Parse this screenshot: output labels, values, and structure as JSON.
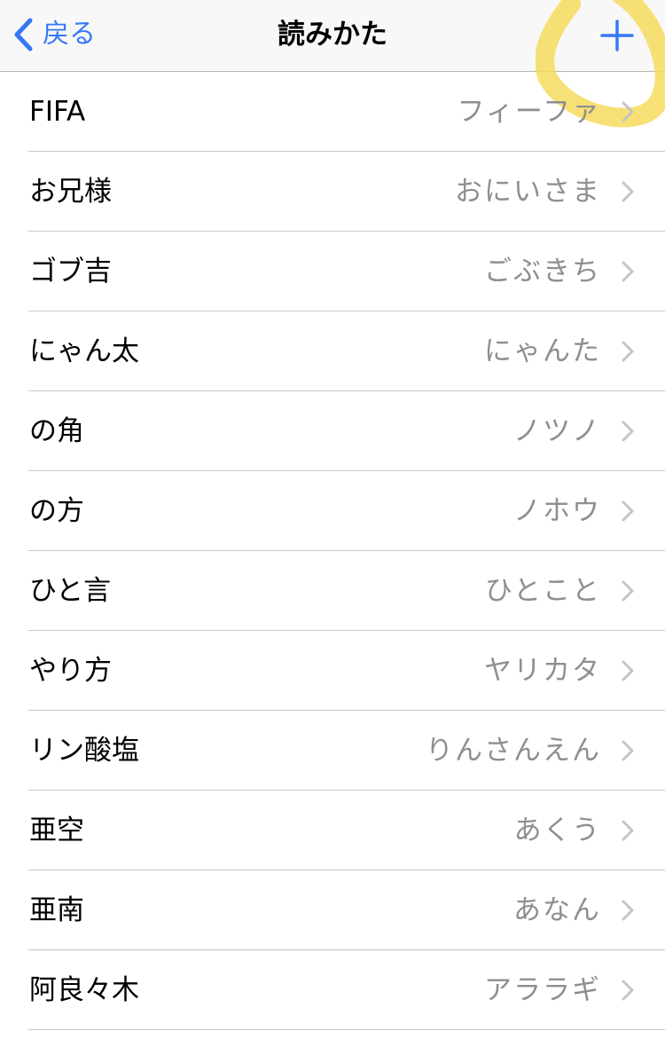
{
  "nav": {
    "back_label": "戻る",
    "title": "読みかた",
    "add_icon": "plus-icon",
    "back_icon": "chevron-left-icon",
    "accent_color": "#3478f6",
    "highlight_color": "#f6dc5e"
  },
  "entries": [
    {
      "word": "FIFA",
      "reading": "フィーファ"
    },
    {
      "word": "お兄様",
      "reading": "おにいさま"
    },
    {
      "word": "ゴブ吉",
      "reading": "ごぶきち"
    },
    {
      "word": "にゃん太",
      "reading": "にゃんた"
    },
    {
      "word": "の角",
      "reading": "ノツノ"
    },
    {
      "word": "の方",
      "reading": "ノホウ"
    },
    {
      "word": "ひと言",
      "reading": "ひとこと"
    },
    {
      "word": "やり方",
      "reading": "ヤリカタ"
    },
    {
      "word": "リン酸塩",
      "reading": "りんさんえん"
    },
    {
      "word": "亜空",
      "reading": "あくう"
    },
    {
      "word": "亜南",
      "reading": "あなん"
    },
    {
      "word": "阿良々木",
      "reading": "アララギ"
    }
  ]
}
